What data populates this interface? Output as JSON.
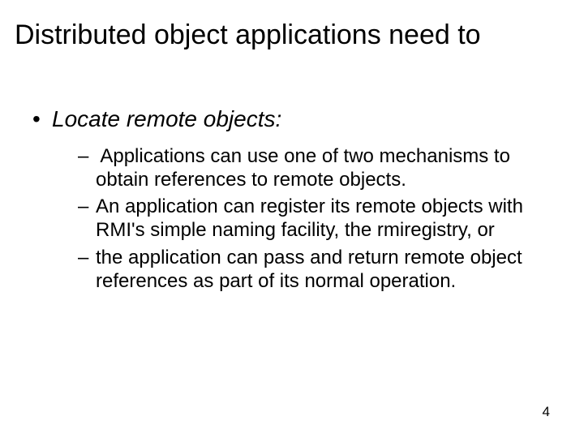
{
  "title": "Distributed object applications need to",
  "topic": {
    "heading": "Locate remote objects:",
    "points": [
      " Applications can use one of two mechanisms to obtain references to remote objects.",
      "An application can register its remote objects with RMI's simple naming facility, the rmiregistry, or",
      "the application can pass and return remote object references as part of its normal operation."
    ]
  },
  "page_number": "4"
}
